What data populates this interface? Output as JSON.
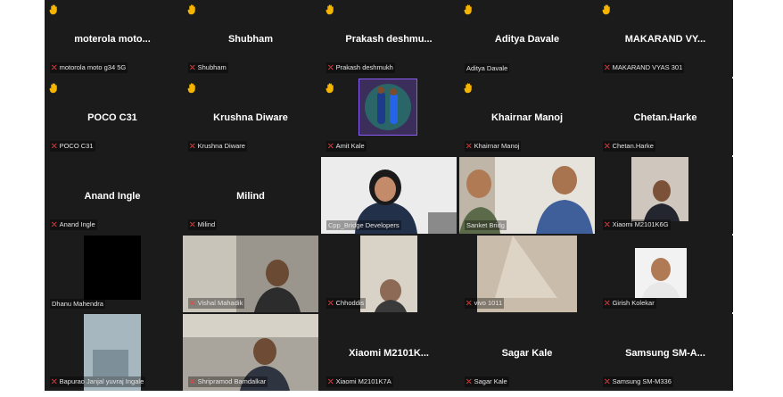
{
  "colors": {
    "grid_bg": "#1b1b1b",
    "muted_mic": "#ef4444",
    "hand": "#f5b400",
    "active_speaker": "#22c55e"
  },
  "tiles": [
    {
      "name": "moterola moto...",
      "label": "motorola moto g34 5G",
      "hand": true,
      "mic_muted": true
    },
    {
      "name": "Shubham",
      "label": "Shubham",
      "hand": true,
      "mic_muted": true
    },
    {
      "name": "Prakash  deshmu...",
      "label": "Prakash deshmukh",
      "hand": true,
      "mic_muted": true
    },
    {
      "name": "Aditya Davale",
      "label": "Aditya Davale",
      "hand": true,
      "mic_muted": false
    },
    {
      "name": "MAKARAND VY...",
      "label": "MAKARAND VYAS 301",
      "hand": true,
      "mic_muted": true
    },
    {
      "name": "POCO C31",
      "label": "POCO C31",
      "hand": true,
      "mic_muted": true
    },
    {
      "name": "Krushna Diware",
      "label": "Krushna Diware",
      "hand": true,
      "mic_muted": true
    },
    {
      "name": "",
      "label": "Amit Kale",
      "hand": true,
      "mic_muted": true
    },
    {
      "name": "Khairnar Manoj",
      "label": "Khairnar Manoj",
      "hand": true,
      "mic_muted": true
    },
    {
      "name": "Chetan.Harke",
      "label": "Chetan.Harke",
      "hand": false,
      "mic_muted": true
    },
    {
      "name": "Anand Ingle",
      "label": "Anand Ingle",
      "hand": false,
      "mic_muted": true
    },
    {
      "name": "Milind",
      "label": "Milind",
      "hand": false,
      "mic_muted": true
    },
    {
      "name": "",
      "label": "Cpp_Bridge Developers",
      "hand": false,
      "mic_muted": false
    },
    {
      "name": "",
      "label": "Sanket Bridg",
      "hand": false,
      "mic_muted": false
    },
    {
      "name": "",
      "label": "Xiaomi M2101K6G",
      "hand": false,
      "mic_muted": true
    },
    {
      "name": "",
      "label": "Dhanu Mahendra",
      "hand": false,
      "mic_muted": false
    },
    {
      "name": "",
      "label": "Vishal Mahadik",
      "hand": false,
      "mic_muted": true
    },
    {
      "name": "",
      "label": "Chhoddis",
      "hand": false,
      "mic_muted": true
    },
    {
      "name": "",
      "label": "vivo 1011",
      "hand": false,
      "mic_muted": true
    },
    {
      "name": "",
      "label": "Girish Kolekar",
      "hand": false,
      "mic_muted": true
    },
    {
      "name": "",
      "label": "Bapurao Janjal yuvraj Ingale",
      "hand": false,
      "mic_muted": true
    },
    {
      "name": "",
      "label": "Shripramod Bamdalkar",
      "hand": false,
      "mic_muted": true
    },
    {
      "name": "Xiaomi M2101K...",
      "label": "Xiaomi M2101K7A",
      "hand": false,
      "mic_muted": true
    },
    {
      "name": "Sagar Kale",
      "label": "Sagar Kale",
      "hand": false,
      "mic_muted": true
    },
    {
      "name": "Samsung  SM-A...",
      "label": "Samsung SM-M336",
      "hand": false,
      "mic_muted": true
    }
  ]
}
